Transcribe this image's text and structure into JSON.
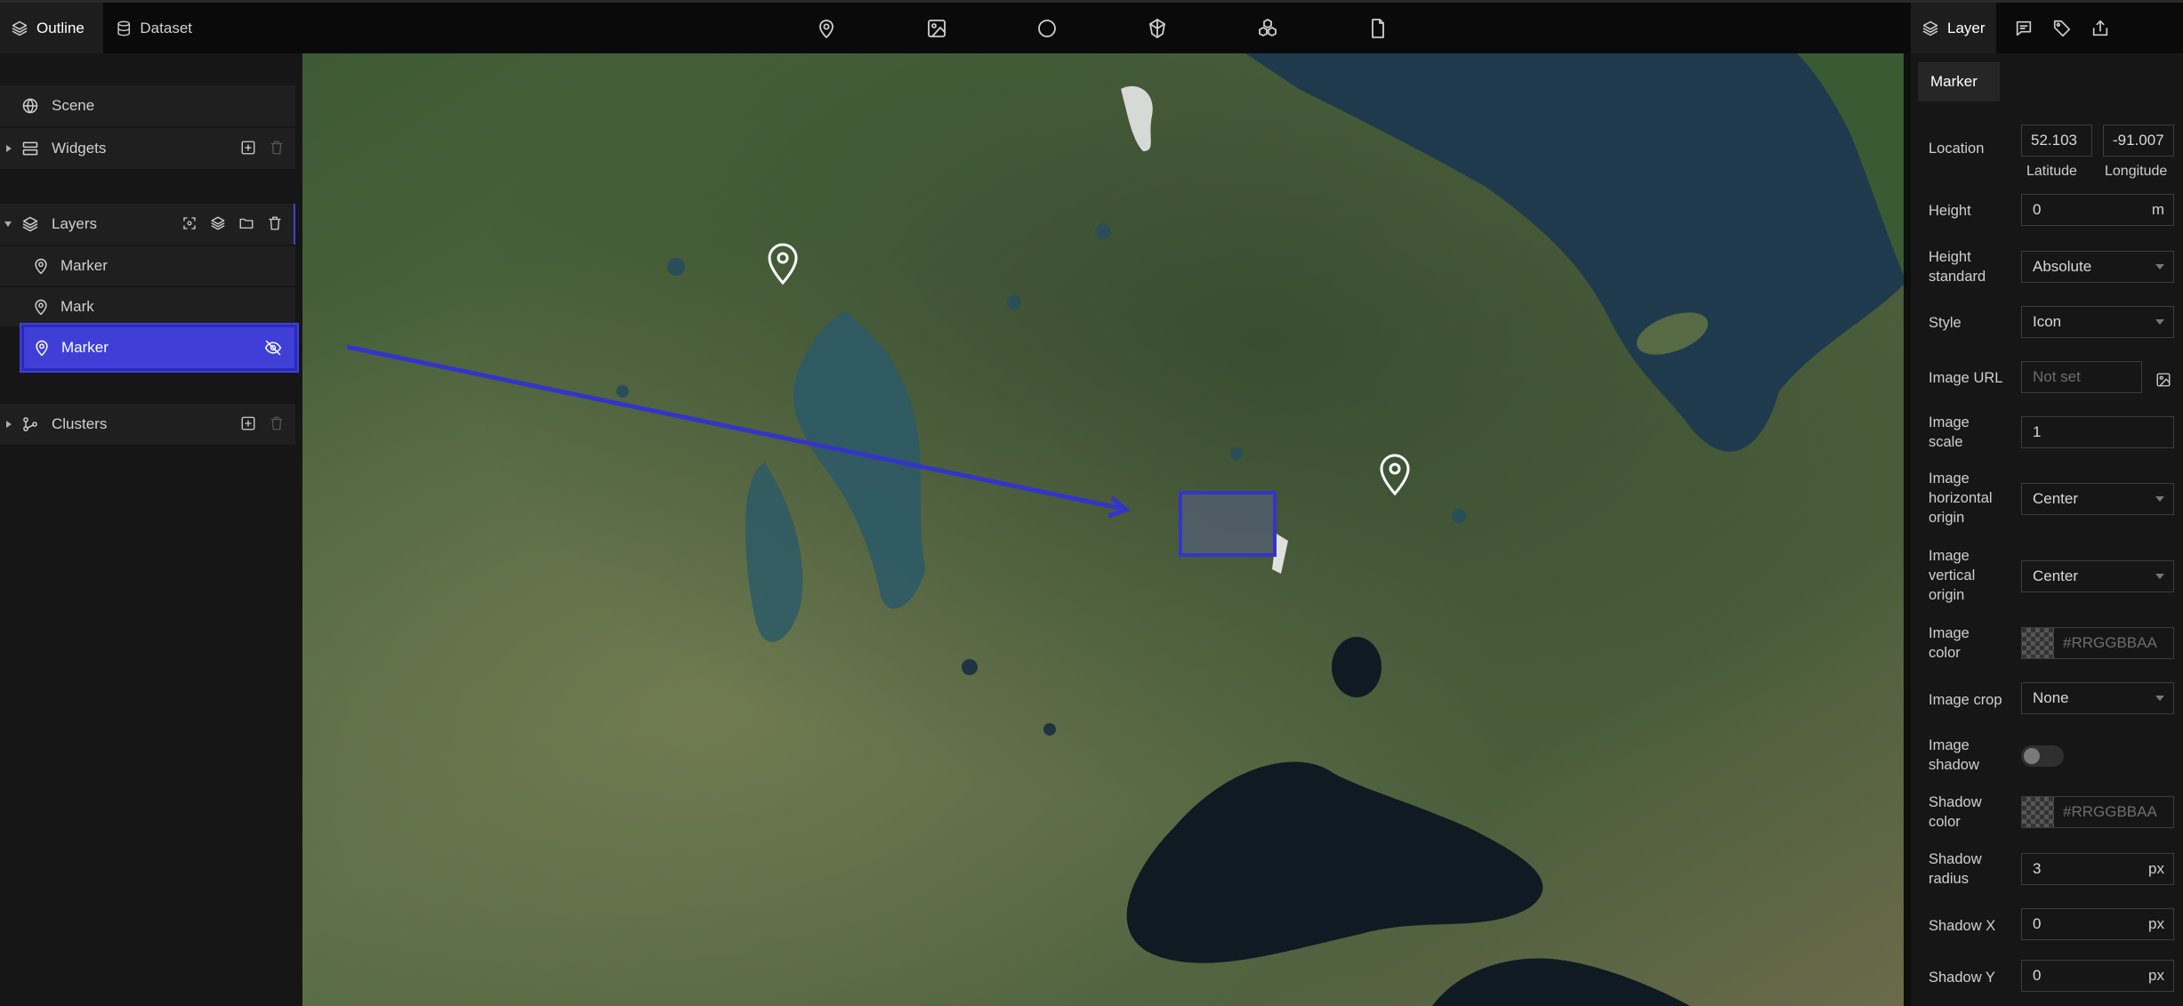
{
  "top_tabs": {
    "outline": "Outline",
    "dataset": "Dataset"
  },
  "toolbar_icons": [
    "marker-icon",
    "image-icon",
    "circle-icon",
    "polyhedron-icon",
    "model-icon",
    "document-icon"
  ],
  "scene_tree": {
    "scene": "Scene",
    "widgets": "Widgets",
    "layers": "Layers",
    "layer_items": [
      "Marker",
      "Mark",
      "Marker"
    ],
    "selected_index": 2,
    "clusters": "Clusters"
  },
  "inspector_tabs": {
    "layer": "Layer"
  },
  "inspector": {
    "section_tab": "Marker",
    "location": {
      "label": "Location",
      "latitude_value": "52.103",
      "longitude_value": "-91.007",
      "latitude_label": "Latitude",
      "longitude_label": "Longitude"
    },
    "height": {
      "label": "Height",
      "value": "0",
      "unit": "m"
    },
    "height_standard": {
      "label": "Height standard",
      "value": "Absolute"
    },
    "style": {
      "label": "Style",
      "value": "Icon"
    },
    "image_url": {
      "label": "Image URL",
      "placeholder": "Not set"
    },
    "image_scale": {
      "label": "Image scale",
      "value": "1"
    },
    "image_horizontal_origin": {
      "label": "Image horizontal origin",
      "value": "Center"
    },
    "image_vertical_origin": {
      "label": "Image vertical origin",
      "value": "Center"
    },
    "image_color": {
      "label": "Image color",
      "placeholder": "#RRGGBBAA"
    },
    "image_crop": {
      "label": "Image crop",
      "value": "None"
    },
    "image_shadow": {
      "label": "Image shadow",
      "enabled": false
    },
    "shadow_color": {
      "label": "Shadow color",
      "placeholder": "#RRGGBBAA"
    },
    "shadow_radius": {
      "label": "Shadow radius",
      "value": "3",
      "unit": "px"
    },
    "shadow_x": {
      "label": "Shadow X",
      "value": "0",
      "unit": "px"
    },
    "shadow_y": {
      "label": "Shadow Y",
      "value": "0",
      "unit": "px"
    }
  },
  "colors": {
    "accent": "#3f3fd8",
    "panel": "#161616",
    "topbar": "#0a0a0a"
  }
}
